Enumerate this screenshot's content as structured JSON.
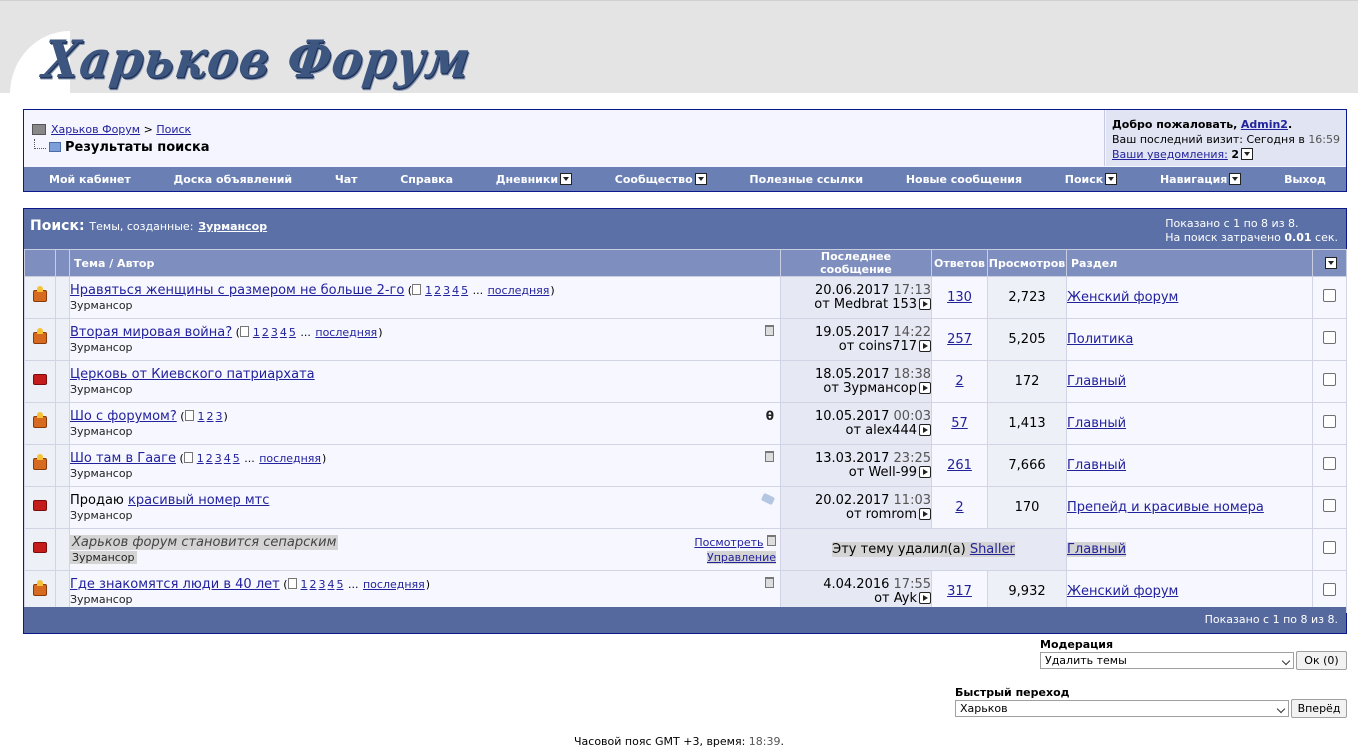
{
  "site": {
    "logo": "Харьков Форум"
  },
  "breadcrumb": {
    "home": "Харьков Форум",
    "sep": ">",
    "parent": "Поиск",
    "current": "Результаты поиска"
  },
  "welcome": {
    "greeting": "Добро пожаловать,",
    "username": "Admin2",
    "dot": ".",
    "last_visit_label": "Ваш последний визит: Сегодня в",
    "last_visit_time": "16:59",
    "notifications_label": "Ваши уведомления:",
    "notifications_count": "2"
  },
  "menu": [
    {
      "label": "Мой кабинет",
      "dropdown": false
    },
    {
      "label": "Доска объявлений",
      "dropdown": false
    },
    {
      "label": "Чат",
      "dropdown": false
    },
    {
      "label": "Справка",
      "dropdown": false
    },
    {
      "label": "Дневники",
      "dropdown": true
    },
    {
      "label": "Сообщество",
      "dropdown": true
    },
    {
      "label": "Полезные ссылки",
      "dropdown": false
    },
    {
      "label": "Новые сообщения",
      "dropdown": false
    },
    {
      "label": "Поиск",
      "dropdown": true
    },
    {
      "label": "Навигация",
      "dropdown": true
    },
    {
      "label": "Выход",
      "dropdown": false
    }
  ],
  "results": {
    "title": "Поиск:",
    "subtitle": "Темы, созданные:",
    "user": "Зурмансор",
    "shown": "Показано с 1 по 8 из 8.",
    "elapsed_prefix": "На поиск затрачено",
    "elapsed_value": "0.01",
    "elapsed_suffix": "сек.",
    "footer": "Показано с 1 по 8 из 8."
  },
  "columns": {
    "topic": "Тема / Автор",
    "last": "Последнее сообщение",
    "replies": "Ответов",
    "views": "Просмотров",
    "forum": "Раздел"
  },
  "threads": [
    {
      "status": "hot",
      "title": "Нравяться женщины с размером не больше 2-го",
      "pages": [
        "1",
        "2",
        "3",
        "4",
        "5"
      ],
      "last_page": "последняя",
      "author": "Зурмансор",
      "icon": "",
      "date": "20.06.2017",
      "time": "17:13",
      "by": "от Medbrat 153",
      "replies": "130",
      "views": "2,723",
      "forum": "Женский форум"
    },
    {
      "status": "hot",
      "title": "Вторая мировая война?",
      "pages": [
        "1",
        "2",
        "3",
        "4",
        "5"
      ],
      "last_page": "последняя",
      "author": "Зурмансор",
      "icon": "trash",
      "date": "19.05.2017",
      "time": "14:22",
      "by": "от coins717",
      "replies": "257",
      "views": "5,205",
      "forum": "Политика"
    },
    {
      "status": "normal",
      "title": "Церковь от Киевского патриархата",
      "pages": [],
      "last_page": "",
      "author": "Зурмансор",
      "icon": "",
      "date": "18.05.2017",
      "time": "18:38",
      "by": "от Зурмансор",
      "replies": "2",
      "views": "172",
      "forum": "Главный"
    },
    {
      "status": "hot",
      "title": "Шо с форумом?",
      "pages": [
        "1",
        "2",
        "3"
      ],
      "last_page": "",
      "author": "Зурмансор",
      "icon": "clip",
      "date": "10.05.2017",
      "time": "00:03",
      "by": "от alex444",
      "replies": "57",
      "views": "1,413",
      "forum": "Главный"
    },
    {
      "status": "hot",
      "title": "Шо там в Гааге",
      "pages": [
        "1",
        "2",
        "3",
        "4",
        "5"
      ],
      "last_page": "последняя",
      "author": "Зурмансор",
      "icon": "trash",
      "date": "13.03.2017",
      "time": "23:25",
      "by": "от Well-99",
      "replies": "261",
      "views": "7,666",
      "forum": "Главный"
    },
    {
      "status": "normal",
      "prefix": "Продаю",
      "title": "красивый номер мтс",
      "pages": [],
      "last_page": "",
      "author": "Зурмансор",
      "icon": "tag",
      "date": "20.02.2017",
      "time": "11:03",
      "by": "от romrom",
      "replies": "2",
      "views": "170",
      "forum": "Препейд и красивые номера"
    },
    {
      "status": "normal",
      "deleted": true,
      "title": "Харьков форум становится сепарским",
      "author": "Зурмансор",
      "view_link": "Посмотреть",
      "manage_link": "Управление",
      "deleted_text": "Эту тему удалил(а)",
      "deleted_by": "Shaller",
      "forum": "Главный"
    },
    {
      "status": "hot",
      "title": "Где знакомятся люди в 40 лет",
      "pages": [
        "1",
        "2",
        "3",
        "4",
        "5"
      ],
      "last_page": "последняя",
      "author": "Зурмансор",
      "icon": "trash",
      "date": "4.04.2016",
      "time": "17:55",
      "by": "от Ayk",
      "replies": "317",
      "views": "9,932",
      "forum": "Женский форум"
    }
  ],
  "moderation": {
    "label": "Модерация",
    "selected": "Удалить темы",
    "button": "Ок (0)"
  },
  "quickjump": {
    "label": "Быстрый переход",
    "selected": "Харьков",
    "button": "Вперёд"
  },
  "footer": {
    "timezone": "Часовой пояс GMT +3, время:",
    "time": "18:39",
    "dot": "."
  }
}
